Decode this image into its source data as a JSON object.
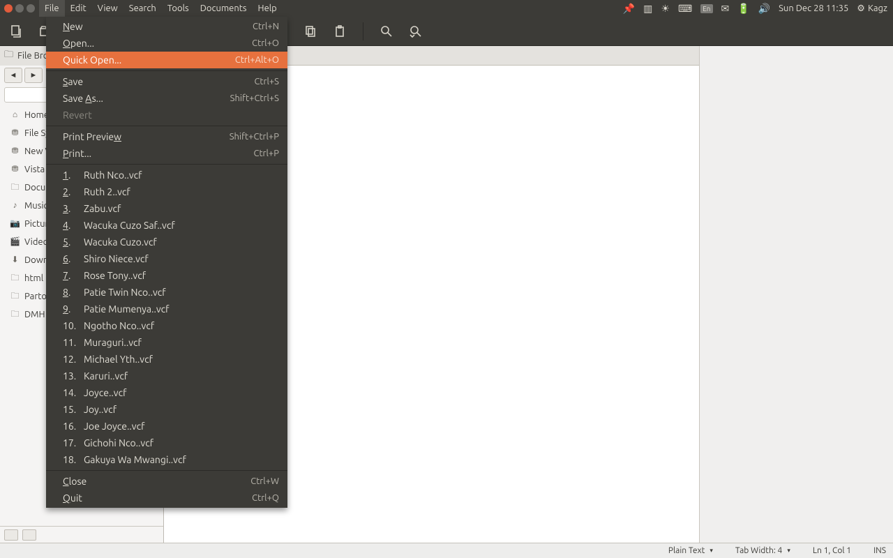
{
  "panel": {
    "menus": [
      "File",
      "Edit",
      "View",
      "Search",
      "Tools",
      "Documents",
      "Help"
    ],
    "datetime": "Sun Dec 28 11:35",
    "user": "Kagz",
    "lang": "En"
  },
  "file_menu": {
    "new": {
      "label": "New",
      "accel": "Ctrl+N"
    },
    "open": {
      "label": "Open...",
      "accel": "Ctrl+O"
    },
    "quick_open": {
      "label": "Quick Open...",
      "accel": "Ctrl+Alt+O"
    },
    "save": {
      "label": "Save",
      "accel": "Ctrl+S"
    },
    "save_as": {
      "label": "Save As...",
      "accel": "Shift+Ctrl+S"
    },
    "revert": {
      "label": "Revert"
    },
    "print_preview": {
      "label": "Print Preview",
      "accel": "Shift+Ctrl+P"
    },
    "print": {
      "label": "Print...",
      "accel": "Ctrl+P"
    },
    "recent": [
      "Ruth Nco..vcf",
      "Ruth 2..vcf",
      "Zabu.vcf",
      "Wacuka Cuzo Saf..vcf",
      "Wacuka Cuzo.vcf",
      "Shiro Niece.vcf",
      "Rose Tony..vcf",
      "Patie Twin Nco..vcf",
      "Patie Mumenya..vcf",
      "Ngotho Nco..vcf",
      "Muraguri..vcf",
      "Michael Yth..vcf",
      "Karuri..vcf",
      "Joyce..vcf",
      "Joy..vcf",
      "Joe Joyce..vcf",
      "Gichohi Nco..vcf",
      "Gakuya Wa  Mwangi..vcf"
    ],
    "close": {
      "label": "Close",
      "accel": "Ctrl+W"
    },
    "quit": {
      "label": "Quit",
      "accel": "Ctrl+Q"
    }
  },
  "sidebar": {
    "title": "File Browser",
    "items": [
      {
        "icon": "home",
        "label": "Home"
      },
      {
        "icon": "drive",
        "label": "File System"
      },
      {
        "icon": "drive",
        "label": "New Volume"
      },
      {
        "icon": "drive",
        "label": "Vista"
      },
      {
        "icon": "folder",
        "label": "Documents"
      },
      {
        "icon": "music",
        "label": "Music"
      },
      {
        "icon": "camera",
        "label": "Pictures"
      },
      {
        "icon": "video",
        "label": "Videos"
      },
      {
        "icon": "download",
        "label": "Downloads"
      },
      {
        "icon": "folder",
        "label": "html"
      },
      {
        "icon": "folder",
        "label": "Partow"
      },
      {
        "icon": "folder",
        "label": "DMH"
      }
    ]
  },
  "status": {
    "syntax": "Plain Text",
    "tab_width": "Tab Width: 4",
    "cursor": "Ln 1, Col 1",
    "mode": "INS"
  }
}
